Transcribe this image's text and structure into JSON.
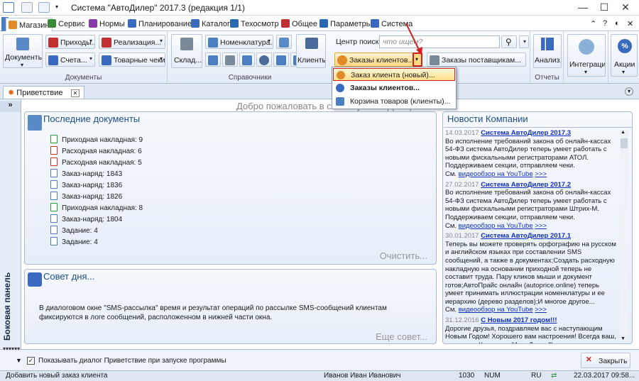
{
  "window": {
    "title": "Система \"АвтоДилер\" 2017.3 (редакция 1/1)"
  },
  "tabs": [
    "Магазин",
    "Сервис",
    "Нормы",
    "Планирование",
    "Каталог",
    "Техосмотр",
    "Общее",
    "Параметры",
    "Система"
  ],
  "ribbon": {
    "documents_btn": "Документы...",
    "prihod": "Приходы...",
    "realizacia": "Реализация...",
    "scheta": "Счета...",
    "tovarnye_cheki": "Товарные чеки...",
    "group_documents": "Документы",
    "sklad": "Склад...",
    "nomenklatura": "Номенклатура...",
    "klienty": "Клиенты...",
    "group_spravochniki": "Справочники",
    "search_label": "Центр поиска :",
    "search_placeholder": "что ищем?",
    "zakazy_klientov": "Заказы клиентов...",
    "zakazy_postavshikam": "Заказы поставщикам...",
    "analiz": "Анализ...",
    "group_otchety": "Отчеты",
    "integracia": "Интеграция",
    "akcii": "Акции"
  },
  "popup_menu": [
    "Заказ клиента (новый)...",
    "Заказы клиентов...",
    "Корзина товаров (клиенты)..."
  ],
  "doc_tab": "Приветствие",
  "side_panel": "Боковая панель",
  "welcome": "Добро пожаловать в систему \"АвтоДилер\"!",
  "recent_docs": {
    "title": "Последние документы",
    "items": [
      "Приходная накладная: 9",
      "Расходная накладная: 6",
      "Расходная накладная: 5",
      "Заказ-наряд: 1843",
      "Заказ-наряд: 1836",
      "Заказ-наряд: 1826",
      "Приходная накладная: 8",
      "Заказ-наряд: 1804",
      "Задание: 4",
      "Задание: 4"
    ],
    "clear": "Очистить..."
  },
  "tip": {
    "title": "Совет дня...",
    "text": "В диалоговом окне \"SMS-рассылка\" время и результат операций по рассылке SMS-сообщений клиентам фиксируются в логе сообщений, расположенном в нижней части окна.",
    "more": "Еще совет..."
  },
  "news": {
    "title": "Новости Компании",
    "items": [
      {
        "date": "14.03.2017",
        "title": "Система АвтоДилер 2017.3",
        "text": "Во исполнение требований закона об онлайн-кассах 54-ФЗ система АвтоДилер теперь умеет работать с новыми фискальными регистраторами АТОЛ. Поддерживаем секции, отправляем чеки.",
        "see": "См.",
        "link": "видеообзор на YouTube",
        "more": ">>>"
      },
      {
        "date": "27.02.2017",
        "title": "Система АвтоДилер 2017.2",
        "text": "Во исполнение требований закона об онлайн-кассах 54-ФЗ система АвтоДилер теперь умеет работать с новыми фискальными регистраторами Штрих-М. Поддерживаем секции, отправляем чеки.",
        "see": "См.",
        "link": "видеообзор на YouTube",
        "more": ">>>"
      },
      {
        "date": "30.01.2017",
        "title": "Система АвтоДилер 2017.1",
        "text": "Теперь вы можете проверять орфографию на русском и английском языках при составлении SMS сообщений, а также в документах;Создать расходную накладную на основании приходной теперь не составит труда. Пару кликов мыши и документ готов;АвтоПрайс онлайн (autoprice.online) теперь умеет принимать иллюстрации номенклатуры и ее иерархию (дерево разделов);И многое другое...",
        "see": "См.",
        "link": "видеообзор на YouTube",
        "more": ">>>"
      },
      {
        "date": "31.12.2016",
        "title": "С Новым 2017 годом!!!",
        "text": "Дорогие друзья, поздравляем вас с наступающим Новым Годом! Хорошего вам настроения! Всегда ваш, коллектив Компании \"АвтоДилер\"!",
        "see": "",
        "link": "",
        "more": ">>>"
      }
    ]
  },
  "bottom": {
    "checkbox_label": "Показывать диалог Приветствие при запуске программы",
    "close": "Закрыть"
  },
  "status": {
    "hint": "Добавить новый заказ клиента",
    "user": "Иванов Иван Иванович",
    "num": "1030",
    "num2": "NUM",
    "lang": "RU",
    "datetime": "22.03.2017 09:58..."
  }
}
